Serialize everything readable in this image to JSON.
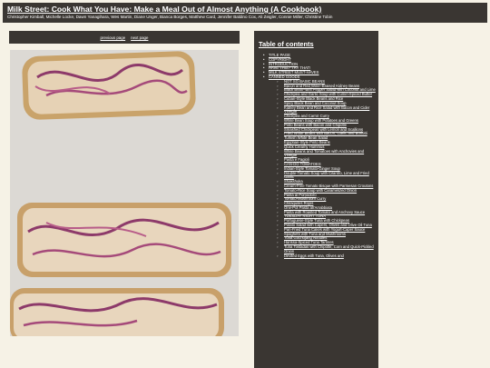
{
  "header": {
    "title": "Milk Street: Cook What You Have: Make a Meal Out of Almost Anything (A Cookbook)",
    "authors": "Christopher Kimball, Michelle Locke, Dawn Yanagihara, Wes Martin, Diane Unger, Bianca Borges, Matthew Card, Jennifer Baldino Cox, Ali Zeigler, Connie Miller, Christine Tobin"
  },
  "nav": {
    "previous": "previous page",
    "next": "next page"
  },
  "toc": {
    "heading": "Table of contents",
    "items": [
      {
        "label": "TITLE PAGE",
        "level": 1
      },
      {
        "label": "COPYRIGHT",
        "level": 1
      },
      {
        "label": "INTRODUCTION",
        "level": 1
      },
      {
        "label": "HAVE THIS? TRY THAT!",
        "level": 1
      },
      {
        "label": "MILK STREET MUST-HAVES",
        "level": 1
      },
      {
        "label": "CANNED GOODS",
        "level": 1
      },
      {
        "label": "NOT SO BASIC BEANS",
        "level": 2
      },
      {
        "label": "Bacon and Red Wine–Braised Kidney Beans",
        "level": 2
      },
      {
        "label": "Black Bean–Bell Pepper Salad with Coconut and Lime",
        "level": 2
      },
      {
        "label": "Chickpea and Garlic Soup with Cumin-Spiced Butter",
        "level": 2
      },
      {
        "label": "Cuban-Style Black Beans and Rice",
        "level": 2
      },
      {
        "label": "Spicy Black Bean and Coconut Soup",
        "level": 2
      },
      {
        "label": "Kidney Bean and Rice Salad with Bacon and Cider Vinegar",
        "level": 2
      },
      {
        "label": "Chickpea and Carrot Curry",
        "level": 2
      },
      {
        "label": "White Bean Soup with Potatoes and Greens",
        "level": 2
      },
      {
        "label": "Pinto Beans with Bacon and Chipotle",
        "level": 2
      },
      {
        "label": "Smashed Chickpeas with Lemon and Scallions",
        "level": 2
      },
      {
        "label": "Fried White Beans with Bacon, Garlic and Borlotti",
        "level": 2
      },
      {
        "label": "Turkish White Bean Salad",
        "level": 2
      },
      {
        "label": "Egyptian-Style Pinto Beans",
        "level": 2
      },
      {
        "label": "Quick Creamy Hummus",
        "level": 2
      },
      {
        "label": "White Beans and Tomatoes with Anchovies and Vinegar",
        "level": 2
      },
      {
        "label": "Pasta e Fagioli",
        "level": 2
      },
      {
        "label": "CAN-DO TOMATOES",
        "level": 2
      },
      {
        "label": "Indian-Style Tomato-Ginger Soup",
        "level": 2
      },
      {
        "label": "Double-Tomato Soup with Cilantro, Lime and Fried Garlic",
        "level": 2
      },
      {
        "label": "Shakshuka",
        "level": 2
      },
      {
        "label": "Cream-Free Tomato Bisque with Parmesan Croutons",
        "level": 2
      },
      {
        "label": "Tomato-Rice Soup with Caramelized Onion",
        "level": 2
      },
      {
        "label": "Pasta al Pomodoro",
        "level": 2
      },
      {
        "label": "Tomato-Mushroom Curry",
        "level": 2
      },
      {
        "label": "Chilaquiles Rojos",
        "level": 2
      },
      {
        "label": "One-Pot Pasta all'Arrabbiata",
        "level": 2
      },
      {
        "label": "Pasta with Roasted Tomato and Anchovy Sauce",
        "level": 2
      },
      {
        "label": "TUESDAY NIGHT TUNA",
        "level": 2
      },
      {
        "label": "Portuguese-Style Tuna with Chickpeas",
        "level": 2
      },
      {
        "label": "Potato Salad with Capers, Olives and Olive Oil Tuna",
        "level": 2
      },
      {
        "label": "Pan-Fried Tuna Cakes with Yogurt-Caper Sauce",
        "level": 2
      },
      {
        "label": "Spaghetti with Tuna and Mushrooms",
        "level": 2
      },
      {
        "label": "Tuna Gochujang Noodles",
        "level": 2
      },
      {
        "label": "Harissa-Spiced Tuna Tartines",
        "level": 2
      },
      {
        "label": "Tuna Tostadas with Chipotle, Corn and Quick-Pickled Onion",
        "level": 2
      },
      {
        "label": "Deviled Eggs with Tuna, Olives and",
        "level": 2
      }
    ]
  }
}
